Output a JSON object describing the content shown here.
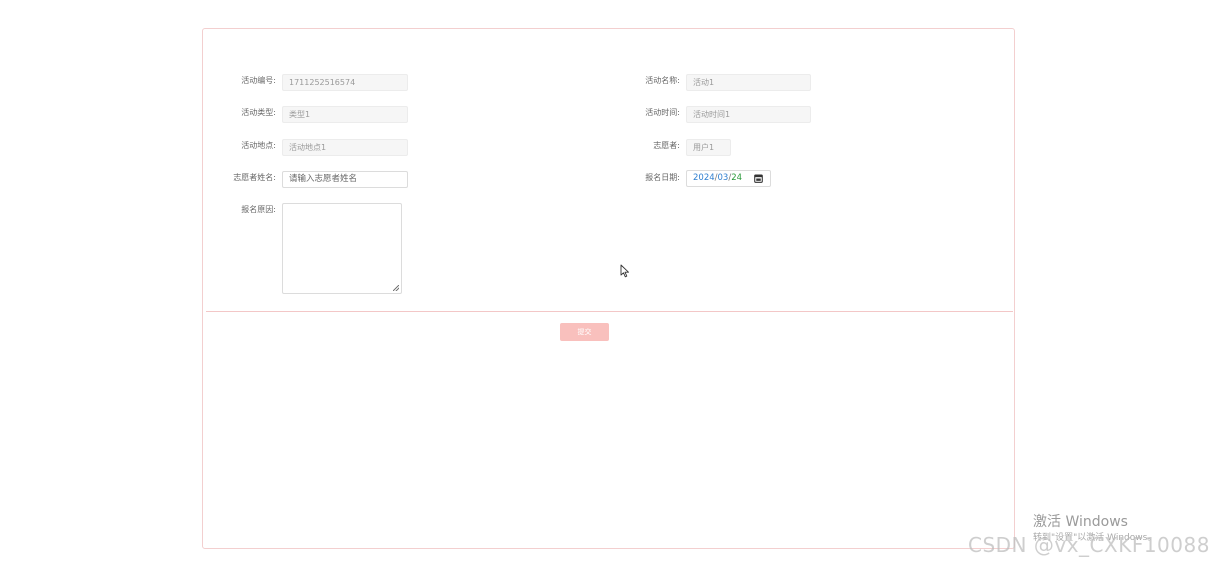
{
  "form": {
    "activity_no": {
      "label": "活动编号:",
      "value": "1711252516574"
    },
    "activity_name": {
      "label": "活动名称:",
      "value": "活动1"
    },
    "activity_type": {
      "label": "活动类型:",
      "value": "类型1"
    },
    "activity_time": {
      "label": "活动时间:",
      "value": "活动时间1"
    },
    "activity_location": {
      "label": "活动地点:",
      "value": "活动地点1"
    },
    "volunteer": {
      "label": "志愿者:",
      "value": "用户1"
    },
    "volunteer_name": {
      "label": "志愿者姓名:",
      "placeholder": "请输入志愿者姓名"
    },
    "signup_date": {
      "label": "报名日期:",
      "year": "2024",
      "month": "03",
      "day": "24",
      "sep": "/"
    },
    "signup_reason": {
      "label": "报名原因:"
    },
    "submit_label": "提交"
  },
  "watermark": {
    "activate_title": "激活 Windows",
    "activate_sub": "转到\"设置\"以激活 Windows。",
    "csdn": "CSDN @vx_CXKF10088"
  },
  "colors": {
    "panel_border": "#f3cfcf",
    "submit_bg": "#f9c0bd",
    "divider": "#f3c7c7"
  }
}
